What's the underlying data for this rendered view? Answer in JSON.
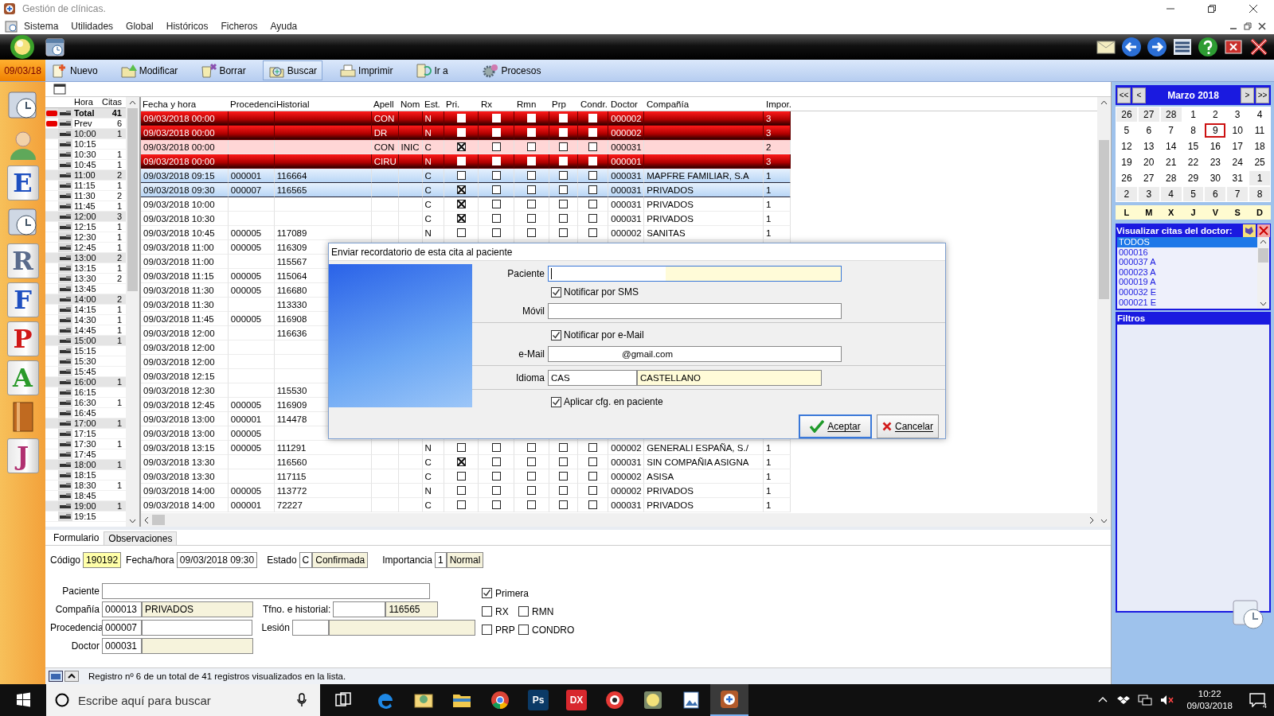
{
  "window": {
    "title": "Gestión de clínicas."
  },
  "menu": [
    "Sistema",
    "Utilidades",
    "Global",
    "Históricos",
    "Ficheros",
    "Ayuda"
  ],
  "top_icons": [
    {
      "kind": "mail"
    },
    {
      "kind": "back"
    },
    {
      "kind": "forward"
    },
    {
      "kind": "list"
    },
    {
      "kind": "help"
    },
    {
      "kind": "close"
    },
    {
      "kind": "exit"
    }
  ],
  "toolbar": {
    "date": "09/03/18",
    "buttons": [
      {
        "label": "Nuevo",
        "kind": "new",
        "selected": false
      },
      {
        "label": "Modificar",
        "kind": "edit",
        "selected": false
      },
      {
        "label": "Borrar",
        "kind": "delete",
        "selected": false
      },
      {
        "label": "Buscar",
        "kind": "search",
        "selected": true
      },
      {
        "label": "Imprimir",
        "kind": "print",
        "selected": false
      },
      {
        "label": "Ir a",
        "kind": "goto",
        "selected": false
      },
      {
        "label": "Procesos",
        "kind": "process",
        "selected": false
      }
    ]
  },
  "sidebar": [
    {
      "kind": "clock"
    },
    {
      "kind": "person"
    },
    {
      "kind": "letter",
      "letter": "E",
      "color": "#1e4fc0"
    },
    {
      "kind": "clock"
    },
    {
      "kind": "letter",
      "letter": "R",
      "color": "#5a6b8c"
    },
    {
      "kind": "letter",
      "letter": "F",
      "color": "#1e4fc0"
    },
    {
      "kind": "letter",
      "letter": "P",
      "color": "#d01818"
    },
    {
      "kind": "letter",
      "letter": "A",
      "color": "#2a9a2a"
    },
    {
      "kind": "book"
    },
    {
      "kind": "letter",
      "letter": "J",
      "color": "#b03070"
    }
  ],
  "hours": {
    "columns": [
      "Hora",
      "Citas"
    ],
    "rows": [
      {
        "kind": "total",
        "hora": "Total",
        "citas": "41"
      },
      {
        "kind": "prev",
        "hora": "Prev",
        "citas": "6"
      },
      {
        "kind": "hour",
        "hora": "10:00",
        "citas": "1"
      },
      {
        "kind": "quarter",
        "hora": "10:15"
      },
      {
        "kind": "quarter",
        "hora": "10:30",
        "citas": "1"
      },
      {
        "kind": "quarter",
        "hora": "10:45",
        "citas": "1"
      },
      {
        "kind": "hour",
        "hora": "11:00",
        "citas": "2"
      },
      {
        "kind": "quarter",
        "hora": "11:15",
        "citas": "1"
      },
      {
        "kind": "quarter",
        "hora": "11:30",
        "citas": "2"
      },
      {
        "kind": "quarter",
        "hora": "11:45",
        "citas": "1"
      },
      {
        "kind": "hour",
        "hora": "12:00",
        "citas": "3"
      },
      {
        "kind": "quarter",
        "hora": "12:15",
        "citas": "1"
      },
      {
        "kind": "quarter",
        "hora": "12:30",
        "citas": "1"
      },
      {
        "kind": "quarter",
        "hora": "12:45",
        "citas": "1"
      },
      {
        "kind": "hour",
        "hora": "13:00",
        "citas": "2"
      },
      {
        "kind": "quarter",
        "hora": "13:15",
        "citas": "1"
      },
      {
        "kind": "quarter",
        "hora": "13:30",
        "citas": "2"
      },
      {
        "kind": "quarter",
        "hora": "13:45"
      },
      {
        "kind": "hour",
        "hora": "14:00",
        "citas": "2"
      },
      {
        "kind": "quarter",
        "hora": "14:15",
        "citas": "1"
      },
      {
        "kind": "quarter",
        "hora": "14:30",
        "citas": "1"
      },
      {
        "kind": "quarter",
        "hora": "14:45",
        "citas": "1"
      },
      {
        "kind": "hour",
        "hora": "15:00",
        "citas": "1"
      },
      {
        "kind": "quarter",
        "hora": "15:15"
      },
      {
        "kind": "quarter",
        "hora": "15:30"
      },
      {
        "kind": "quarter",
        "hora": "15:45"
      },
      {
        "kind": "hour",
        "hora": "16:00",
        "citas": "1"
      },
      {
        "kind": "quarter",
        "hora": "16:15"
      },
      {
        "kind": "quarter",
        "hora": "16:30",
        "citas": "1"
      },
      {
        "kind": "quarter",
        "hora": "16:45"
      },
      {
        "kind": "hour",
        "hora": "17:00",
        "citas": "1"
      },
      {
        "kind": "quarter",
        "hora": "17:15"
      },
      {
        "kind": "quarter",
        "hora": "17:30",
        "citas": "1"
      },
      {
        "kind": "quarter",
        "hora": "17:45"
      },
      {
        "kind": "hour",
        "hora": "18:00",
        "citas": "1"
      },
      {
        "kind": "quarter",
        "hora": "18:15"
      },
      {
        "kind": "quarter",
        "hora": "18:30",
        "citas": "1"
      },
      {
        "kind": "quarter",
        "hora": "18:45"
      },
      {
        "kind": "hour",
        "hora": "19:00",
        "citas": "1"
      },
      {
        "kind": "quarter",
        "hora": "19:15"
      }
    ]
  },
  "table": {
    "columns": [
      "Fecha y hora",
      "Procedenci",
      "Historial",
      "Apell",
      "Nom",
      "Est.",
      "Pri.",
      "Rx",
      "Rmn",
      "Prp",
      "Condr.",
      "Doctor",
      "Compañía",
      "Impor."
    ],
    "rows": [
      {
        "kind": "alert",
        "selected": false,
        "fecha": "09/03/2018 00:00",
        "apell": "CON",
        "est": "N",
        "pri": false,
        "rx": false,
        "rmn": false,
        "prp": false,
        "condr": false,
        "doctor": "000002",
        "impor": "3"
      },
      {
        "kind": "alert",
        "selected": false,
        "fecha": "09/03/2018 00:00",
        "apell": "DR",
        "est": "N",
        "pri": false,
        "rx": false,
        "rmn": false,
        "prp": false,
        "condr": false,
        "doctor": "000002",
        "impor": "3"
      },
      {
        "kind": "warning",
        "selected": false,
        "fecha": "09/03/2018 00:00",
        "apell": "CON",
        "nom": "INIC",
        "est": "C",
        "pri": true,
        "rx": false,
        "rmn": false,
        "prp": false,
        "condr": false,
        "doctor": "000031",
        "impor": "2"
      },
      {
        "kind": "alert",
        "selected": false,
        "fecha": "09/03/2018 00:00",
        "apell": "CIRU",
        "est": "N",
        "pri": false,
        "rx": false,
        "rmn": false,
        "prp": false,
        "condr": false,
        "doctor": "000001",
        "impor": "3"
      },
      {
        "kind": "normal",
        "selected": true,
        "fecha": "09/03/2018 09:15",
        "procedencia": "000001",
        "historial": "116664",
        "est": "C",
        "pri": false,
        "rx": false,
        "rmn": false,
        "prp": false,
        "condr": false,
        "doctor": "000031",
        "compania": "MAPFRE FAMILIAR, S.A",
        "impor": "1"
      },
      {
        "kind": "normal",
        "selected": true,
        "fecha": "09/03/2018 09:30",
        "procedencia": "000007",
        "historial": "116565",
        "est": "C",
        "pri": true,
        "rx": false,
        "rmn": false,
        "prp": false,
        "condr": false,
        "doctor": "000031",
        "compania": "PRIVADOS",
        "impor": "1"
      },
      {
        "kind": "normal",
        "selected": false,
        "fecha": "09/03/2018 10:00",
        "est": "C",
        "pri": true,
        "rx": false,
        "rmn": false,
        "prp": false,
        "condr": false,
        "doctor": "000031",
        "compania": "PRIVADOS",
        "impor": "1"
      },
      {
        "kind": "normal",
        "selected": false,
        "fecha": "09/03/2018 10:30",
        "est": "C",
        "pri": true,
        "rx": false,
        "rmn": false,
        "prp": false,
        "condr": false,
        "doctor": "000031",
        "compania": "PRIVADOS",
        "impor": "1"
      },
      {
        "kind": "normal",
        "selected": false,
        "fecha": "09/03/2018 10:45",
        "procedencia": "000005",
        "historial": "117089",
        "est": "N",
        "pri": false,
        "rx": false,
        "rmn": false,
        "prp": false,
        "condr": false,
        "doctor": "000002",
        "compania": "SANITAS",
        "impor": "1"
      },
      {
        "kind": "normal",
        "selected": false,
        "fecha": "09/03/2018 11:00",
        "procedencia": "000005",
        "historial": "116309"
      },
      {
        "kind": "normal",
        "selected": false,
        "fecha": "09/03/2018 11:00",
        "historial": "115567"
      },
      {
        "kind": "normal",
        "selected": false,
        "fecha": "09/03/2018 11:15",
        "procedencia": "000005",
        "historial": "115064"
      },
      {
        "kind": "normal",
        "selected": false,
        "fecha": "09/03/2018 11:30",
        "procedencia": "000005",
        "historial": "116680"
      },
      {
        "kind": "normal",
        "selected": false,
        "fecha": "09/03/2018 11:30",
        "historial": "113330"
      },
      {
        "kind": "normal",
        "selected": false,
        "fecha": "09/03/2018 11:45",
        "procedencia": "000005",
        "historial": "116908"
      },
      {
        "kind": "normal",
        "selected": false,
        "fecha": "09/03/2018 12:00",
        "historial": "116636"
      },
      {
        "kind": "normal",
        "selected": false,
        "fecha": "09/03/2018 12:00"
      },
      {
        "kind": "normal",
        "selected": false,
        "fecha": "09/03/2018 12:00"
      },
      {
        "kind": "normal",
        "selected": false,
        "fecha": "09/03/2018 12:15"
      },
      {
        "kind": "normal",
        "selected": false,
        "fecha": "09/03/2018 12:30",
        "historial": "115530"
      },
      {
        "kind": "normal",
        "selected": false,
        "fecha": "09/03/2018 12:45",
        "procedencia": "000005",
        "historial": "116909"
      },
      {
        "kind": "normal",
        "selected": false,
        "fecha": "09/03/2018 13:00",
        "procedencia": "000001",
        "historial": "114478"
      },
      {
        "kind": "normal",
        "selected": false,
        "fecha": "09/03/2018 13:00",
        "procedencia": "000005"
      },
      {
        "kind": "normal",
        "selected": false,
        "fecha": "09/03/2018 13:15",
        "procedencia": "000005",
        "historial": "111291",
        "est": "N",
        "pri": false,
        "rx": false,
        "rmn": false,
        "prp": false,
        "condr": false,
        "doctor": "000002",
        "compania": "GENERALI ESPAÑA, S./",
        "impor": "1"
      },
      {
        "kind": "normal",
        "selected": false,
        "fecha": "09/03/2018 13:30",
        "historial": "116560",
        "est": "C",
        "pri": true,
        "rx": false,
        "rmn": false,
        "prp": false,
        "condr": false,
        "doctor": "000031",
        "compania": "SIN COMPAÑIA ASIGNA",
        "impor": "1"
      },
      {
        "kind": "normal",
        "selected": false,
        "fecha": "09/03/2018 13:30",
        "historial": "117115",
        "est": "C",
        "pri": false,
        "rx": false,
        "rmn": false,
        "prp": false,
        "condr": false,
        "doctor": "000002",
        "compania": "ASISA",
        "impor": "1"
      },
      {
        "kind": "normal",
        "selected": false,
        "fecha": "09/03/2018 14:00",
        "procedencia": "000005",
        "historial": "113772",
        "est": "N",
        "pri": false,
        "rx": false,
        "rmn": false,
        "prp": false,
        "condr": false,
        "doctor": "000002",
        "compania": "PRIVADOS",
        "impor": "1"
      },
      {
        "kind": "normal",
        "selected": false,
        "fecha": "09/03/2018 14:00",
        "procedencia": "000001",
        "historial": "72227",
        "est": "C",
        "pri": false,
        "rx": false,
        "rmn": false,
        "prp": false,
        "condr": false,
        "doctor": "000031",
        "compania": "PRIVADOS",
        "impor": "1"
      }
    ]
  },
  "dialog": {
    "title": "Enviar recordatorio de esta cita al paciente",
    "paciente": {
      "label": "Paciente"
    },
    "sms": {
      "label": "Notificar por SMS",
      "checked": true
    },
    "movil": {
      "label": "Móvil"
    },
    "email_check": {
      "label": "Notificar por e-Mail",
      "checked": true
    },
    "email": {
      "label": "e-Mail",
      "value": "@gmail.com"
    },
    "idioma": {
      "label": "Idioma",
      "code": "CAS",
      "value": "CASTELLANO"
    },
    "aplicar": {
      "label": "Aplicar cfg. en paciente",
      "checked": true
    },
    "buttons": [
      {
        "label": "Aceptar",
        "kind": "ok"
      },
      {
        "label": "Cancelar",
        "kind": "cancel"
      }
    ]
  },
  "calendar": {
    "title": "Marzo 2018",
    "nav": [
      "<<",
      "<",
      ">",
      ">>"
    ],
    "weeks": [
      [
        {
          "label": "26",
          "outside": true,
          "selected": false
        },
        {
          "label": "27",
          "outside": true,
          "selected": false
        },
        {
          "label": "28",
          "outside": true,
          "selected": false
        },
        {
          "label": "1",
          "outside": false,
          "selected": false
        },
        {
          "label": "2",
          "outside": false,
          "selected": false
        },
        {
          "label": "3",
          "outside": false,
          "selected": false
        },
        {
          "label": "4",
          "outside": false,
          "selected": false
        }
      ],
      [
        {
          "label": "5",
          "outside": false,
          "selected": false
        },
        {
          "label": "6",
          "outside": false,
          "selected": false
        },
        {
          "label": "7",
          "outside": false,
          "selected": false
        },
        {
          "label": "8",
          "outside": false,
          "selected": false
        },
        {
          "label": "9",
          "outside": false,
          "selected": true
        },
        {
          "label": "10",
          "outside": false,
          "selected": false
        },
        {
          "label": "11",
          "outside": false,
          "selected": false
        }
      ],
      [
        {
          "label": "12",
          "outside": false,
          "selected": false
        },
        {
          "label": "13",
          "outside": false,
          "selected": false
        },
        {
          "label": "14",
          "outside": false,
          "selected": false
        },
        {
          "label": "15",
          "outside": false,
          "selected": false
        },
        {
          "label": "16",
          "outside": false,
          "selected": false
        },
        {
          "label": "17",
          "outside": false,
          "selected": false
        },
        {
          "label": "18",
          "outside": false,
          "selected": false
        }
      ],
      [
        {
          "label": "19",
          "outside": false,
          "selected": false
        },
        {
          "label": "20",
          "outside": false,
          "selected": false
        },
        {
          "label": "21",
          "outside": false,
          "selected": false
        },
        {
          "label": "22",
          "outside": false,
          "selected": false
        },
        {
          "label": "23",
          "outside": false,
          "selected": false
        },
        {
          "label": "24",
          "outside": false,
          "selected": false
        },
        {
          "label": "25",
          "outside": false,
          "selected": false
        }
      ],
      [
        {
          "label": "26",
          "outside": false,
          "selected": false
        },
        {
          "label": "27",
          "outside": false,
          "selected": false
        },
        {
          "label": "28",
          "outside": false,
          "selected": false
        },
        {
          "label": "29",
          "outside": false,
          "selected": false
        },
        {
          "label": "30",
          "outside": false,
          "selected": false
        },
        {
          "label": "31",
          "outside": false,
          "selected": false
        },
        {
          "label": "1",
          "outside": true,
          "selected": false
        }
      ],
      [
        {
          "label": "2",
          "outside": true,
          "selected": false
        },
        {
          "label": "3",
          "outside": true,
          "selected": false
        },
        {
          "label": "4",
          "outside": true,
          "selected": false
        },
        {
          "label": "5",
          "outside": true,
          "selected": false
        },
        {
          "label": "6",
          "outside": true,
          "selected": false
        },
        {
          "label": "7",
          "outside": true,
          "selected": false
        },
        {
          "label": "8",
          "outside": true,
          "selected": false
        }
      ]
    ],
    "weekdays": [
      "L",
      "M",
      "X",
      "J",
      "V",
      "S",
      "D"
    ]
  },
  "doctors": {
    "title": "Visualizar citas del doctor:",
    "items": [
      {
        "label": "TODOS",
        "selected": true
      },
      {
        "label": "000016",
        "selected": false
      },
      {
        "label": "000037 A",
        "selected": false
      },
      {
        "label": "000023 A",
        "selected": false
      },
      {
        "label": "000019 A",
        "selected": false
      },
      {
        "label": "000032 E",
        "selected": false
      },
      {
        "label": "000021 E",
        "selected": false
      }
    ]
  },
  "filters": {
    "title": "Filtros"
  },
  "form": {
    "tabs": [
      {
        "label": "Formulario",
        "selected": true
      },
      {
        "label": "Observaciones",
        "selected": false
      }
    ],
    "codigo": {
      "label": "Código",
      "value": "190192"
    },
    "fecha": {
      "label": "Fecha/hora",
      "value": "09/03/2018 09:30"
    },
    "estado": {
      "label": "Estado",
      "code": "C",
      "value": "Confirmada"
    },
    "importancia": {
      "label": "Importancia",
      "code": "1",
      "value": "Normal"
    },
    "paciente": {
      "label": "Paciente"
    },
    "compania": {
      "label": "Compañía",
      "code": "000013",
      "value": "PRIVADOS"
    },
    "telefono": {
      "label": "Tfno. e historial:",
      "value": "116565"
    },
    "procedencia": {
      "label": "Procedencia",
      "code": "000007"
    },
    "lesion": {
      "label": "Lesión"
    },
    "doctor": {
      "label": "Doctor",
      "code": "000031"
    },
    "checks": [
      {
        "label": "Primera",
        "checked": true
      },
      {
        "label": "RX",
        "checked": false
      },
      {
        "label": "RMN",
        "checked": false
      },
      {
        "label": "PRP",
        "checked": false
      },
      {
        "label": "CONDRO",
        "checked": false
      }
    ]
  },
  "status_bar": "Registro nº 6 de un total de 41 registros visualizados en la lista.",
  "taskbar": {
    "search_placeholder": "Escribe aquí para buscar",
    "apps": [
      {
        "kind": "edge",
        "selected": false
      },
      {
        "kind": "mail",
        "selected": false
      },
      {
        "kind": "folder",
        "selected": false
      },
      {
        "kind": "chrome",
        "selected": false
      },
      {
        "kind": "label",
        "label": "Ps",
        "color": "#0b3a66",
        "selected": false
      },
      {
        "kind": "label",
        "label": "DX",
        "color": "#d8282e",
        "selected": false
      },
      {
        "kind": "disc",
        "selected": false
      },
      {
        "kind": "orb",
        "selected": false
      },
      {
        "kind": "picture",
        "selected": false
      },
      {
        "kind": "clinic",
        "selected": true
      }
    ],
    "time": "10:22",
    "date": "09/03/2018",
    "notifications": "4"
  }
}
